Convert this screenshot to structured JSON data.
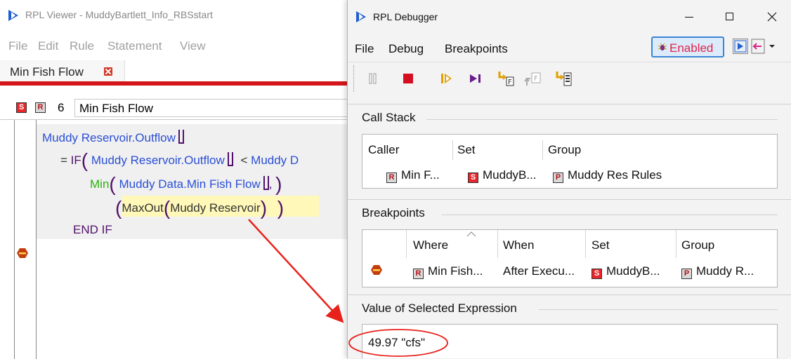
{
  "viewer": {
    "title": "RPL Viewer - MuddyBartlett_Info_RBSstart",
    "menu": [
      "File",
      "Edit",
      "Rule",
      "Statement",
      "View"
    ],
    "tab_label": "Min Fish Flow",
    "rule": {
      "number": "6",
      "name": "Min Fish Flow"
    },
    "code": {
      "line1": "Muddy Reservoir.Outflow",
      "line2_eq": "=",
      "line2_if": "IF",
      "line2_expr": "Muddy Reservoir.Outflow",
      "line2_op": "<",
      "line2_tail": "Muddy D",
      "line3_min": "Min",
      "line3_arg": "Muddy Data.Min Fish Flow",
      "line3_comma": ",",
      "line4_maxout": "MaxOut",
      "line4_arg": "Muddy Reservoir",
      "line5": "END IF"
    }
  },
  "debugger": {
    "title": "RPL Debugger",
    "menu": [
      "File",
      "Debug",
      "Breakpoints"
    ],
    "enabled_label": "Enabled",
    "toolbar_icons": [
      "pause-icon",
      "stop-icon",
      "continue-icon",
      "step-icon",
      "step-into-function-icon",
      "step-out-function-icon",
      "step-to-end-icon"
    ],
    "call_stack": {
      "label": "Call Stack",
      "columns": [
        "Caller",
        "Set",
        "Group"
      ],
      "rows": [
        {
          "caller": "Min F...",
          "set": "MuddyB...",
          "group": "Muddy Res Rules"
        }
      ]
    },
    "breakpoints": {
      "label": "Breakpoints",
      "columns": [
        "Where",
        "When",
        "Set",
        "Group"
      ],
      "rows": [
        {
          "where": "Min Fish...",
          "when": "After Execu...",
          "set": "MuddyB...",
          "group": "Muddy R..."
        }
      ]
    },
    "value": {
      "label": "Value of Selected Expression",
      "text": "49.97 \"cfs\""
    }
  },
  "colors": {
    "accent_red": "#d4161b",
    "code_blue": "#2b4fd6",
    "code_green": "#2bb10f",
    "code_purple": "#50116b",
    "highlight": "#fff8b8",
    "enabled_text": "#e0244a"
  }
}
